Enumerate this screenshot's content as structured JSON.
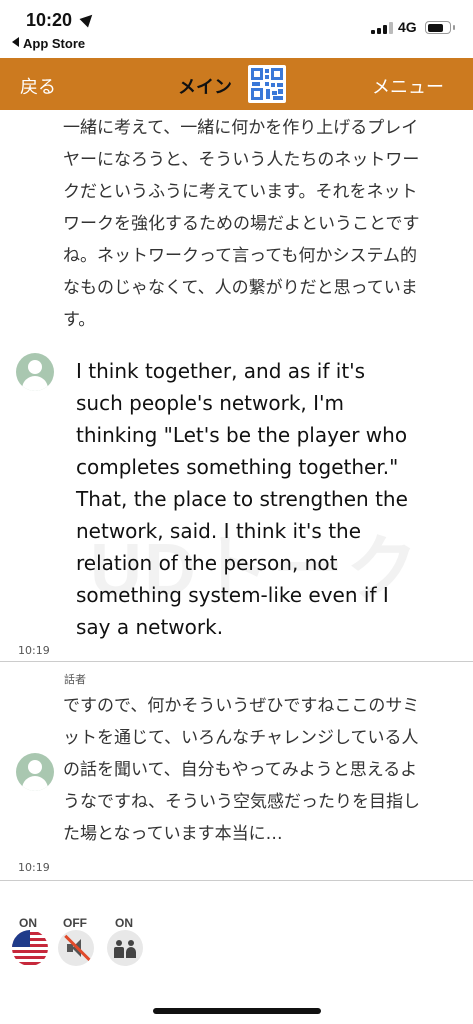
{
  "status_bar": {
    "time": "10:20",
    "back_app": "App Store",
    "network": "4G"
  },
  "nav": {
    "back_label": "戻る",
    "title": "メイン",
    "menu_label": "メニュー",
    "qr_icon": "qr-code-icon",
    "color": "#cc7a1f"
  },
  "messages": [
    {
      "lines": [
        "一緒に考えて、一緒に何かを作り上げるプレイ",
        "ヤーになろうと、そういう人たちのネットワー",
        "クだというふうに考えています。それをネット",
        "ワークを強化するための場だよということです",
        "ね。ネットワークって言っても何かシステム的",
        "なものじゃなくて、人の繋がりだと思っていま",
        "す。"
      ]
    },
    {
      "lines": [
        "I think together, and as if it's",
        "such people's network, I'm",
        "thinking \"Let's be the player who",
        "completes something together.\"",
        "That, the place to strengthen the",
        "network, said. I think it's the",
        "relation of the person, not",
        "something system-like even if I",
        "say a network."
      ],
      "time": "10:19"
    },
    {
      "speaker": "話者",
      "lines": [
        "ですので、何かそういうぜひですねここのサミ",
        "ットを通じて、いろんなチャレンジしている人",
        "の話を聞いて、自分もやってみようと思えるよ",
        "うなですね、そういう空気感だったりを目指し",
        "た場となっています本当に…"
      ],
      "time": "10:19"
    }
  ],
  "toolbar": {
    "english": {
      "state": "ON",
      "icon": "us-flag-icon"
    },
    "audio": {
      "state": "OFF",
      "icon": "speaker-muted-icon"
    },
    "kids": {
      "state": "ON",
      "icon": "kids-icon"
    }
  }
}
